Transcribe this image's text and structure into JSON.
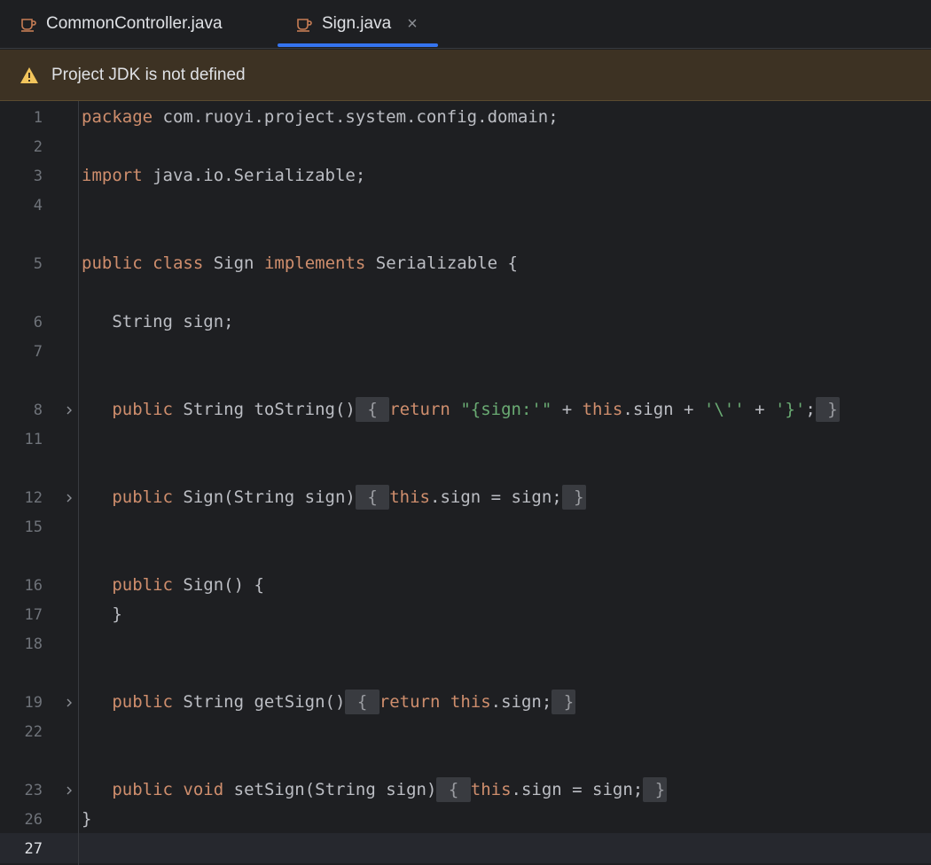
{
  "tabs": [
    {
      "label": "CommonController.java",
      "icon": "java-class-icon"
    },
    {
      "label": "Sign.java",
      "icon": "java-class-icon",
      "active": true,
      "close": "×"
    }
  ],
  "banner": {
    "icon": "warning-icon",
    "text": "Project JDK is not defined"
  },
  "editor": {
    "lines": [
      {
        "num": "1"
      },
      {
        "num": "2"
      },
      {
        "num": "3"
      },
      {
        "num": "4"
      },
      {
        "num": "5"
      },
      {
        "num": "6"
      },
      {
        "num": "7"
      },
      {
        "num": "8"
      },
      {
        "num": "11"
      },
      {
        "num": "12"
      },
      {
        "num": "15"
      },
      {
        "num": "16"
      },
      {
        "num": "17"
      },
      {
        "num": "18"
      },
      {
        "num": "19"
      },
      {
        "num": "22"
      },
      {
        "num": "23"
      },
      {
        "num": "26"
      },
      {
        "num": "27"
      }
    ],
    "code": {
      "l1_kw": "package",
      "l1_rest": " com.ruoyi.project.system.config.domain;",
      "l3_kw": "import",
      "l3_rest": " java.io.Serializable;",
      "l5_kw1": "public",
      "l5_kw2": "class",
      "l5_name": " Sign ",
      "l5_kw3": "implements",
      "l5_rest": " Serializable {",
      "l6": "String sign;",
      "l8_kw": "public",
      "l8_a": " String toString()",
      "l8_b1": "{",
      "l8_kw2": "return",
      "l8_s1": "\"{sign:'\"",
      "l8_c": " + ",
      "l8_kw3": "this",
      "l8_d": ".sign + ",
      "l8_s2": "'\\''",
      "l8_e": " + ",
      "l8_s3": "'}'",
      "l8_f": ";",
      "l8_b2": "}",
      "l12_kw": "public",
      "l12_a": " Sign(String sign)",
      "l12_b1": "{",
      "l12_kw2": "this",
      "l12_c": ".sign = sign;",
      "l12_b2": "}",
      "l16_kw": "public",
      "l16_a": " Sign() {",
      "l17": "}",
      "l19_kw": "public",
      "l19_a": " String getSign()",
      "l19_b1": "{",
      "l19_kw2": "return",
      "l19_kw3": "this",
      "l19_c": ".sign;",
      "l19_b2": "}",
      "l23_kw": "public",
      "l23_kw2": "void",
      "l23_a": " setSign(String sign)",
      "l23_b1": "{",
      "l23_kw3": "this",
      "l23_c": ".sign = sign;",
      "l23_b2": "}",
      "l26": "}"
    }
  },
  "colors": {
    "keyword": "#cf8e6d",
    "string": "#6aab73",
    "accent": "#3574f0",
    "warning": "#f2c55c"
  }
}
